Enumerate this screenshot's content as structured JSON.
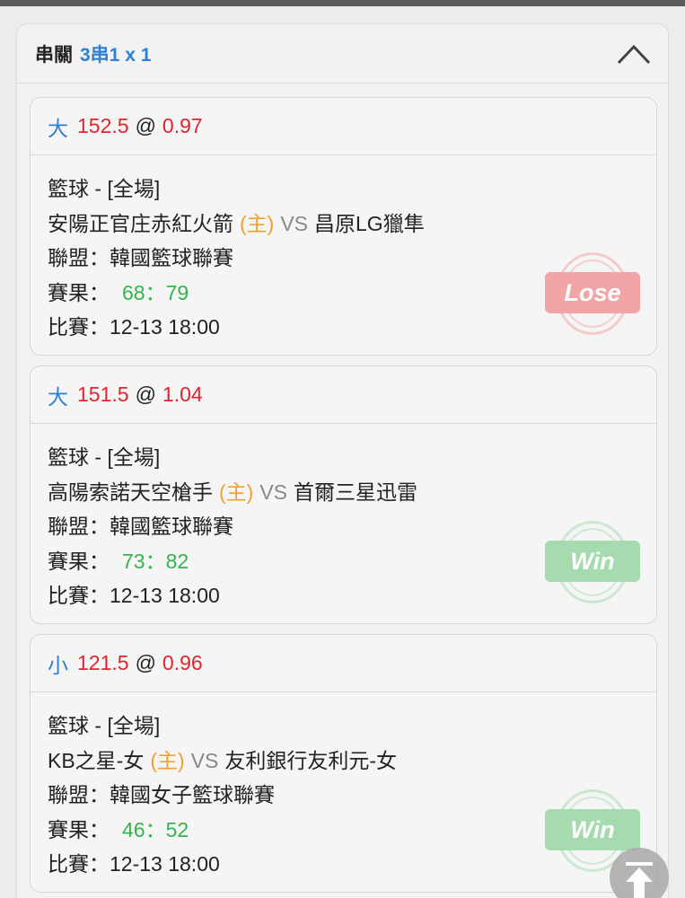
{
  "header": {
    "title": "串關",
    "combo": "3串1 x 1"
  },
  "labels": {
    "vs": "VS",
    "home_tag": "(主)",
    "league_prefix": "聯盟：",
    "result_prefix": "賽果：",
    "time_prefix": "比賽："
  },
  "bets": [
    {
      "pick": "大",
      "line": "152.5",
      "at": "@",
      "odds": "0.97",
      "sport": "籃球 - [全場]",
      "home_team": "安陽正官庄赤紅火箭",
      "away_team": "昌原LG獵隼",
      "league": "韓國籃球聯賽",
      "score": "68：79",
      "time": "12-13 18:00",
      "status": "Lose"
    },
    {
      "pick": "大",
      "line": "151.5",
      "at": "@",
      "odds": "1.04",
      "sport": "籃球 - [全場]",
      "home_team": "高陽索諾天空槍手",
      "away_team": "首爾三星迅雷",
      "league": "韓國籃球聯賽",
      "score": "73：82",
      "time": "12-13 18:00",
      "status": "Win"
    },
    {
      "pick": "小",
      "line": "121.5",
      "at": "@",
      "odds": "0.96",
      "sport": "籃球 - [全場]",
      "home_team": "KB之星-女",
      "away_team": "友利銀行友利元-女",
      "league": "韓國女子籃球聯賽",
      "score": "46：52",
      "time": "12-13 18:00",
      "status": "Win"
    }
  ],
  "icons": {
    "collapse": "chevron-up-icon",
    "scroll_top": "arrow-up-icon"
  },
  "colors": {
    "pick": "#2f7fd6",
    "odds": "#e0242f",
    "home_tag": "#f0a033",
    "score": "#35b44a",
    "lose_stamp": "#f2a5a7",
    "win_stamp": "#a6dbb0"
  }
}
